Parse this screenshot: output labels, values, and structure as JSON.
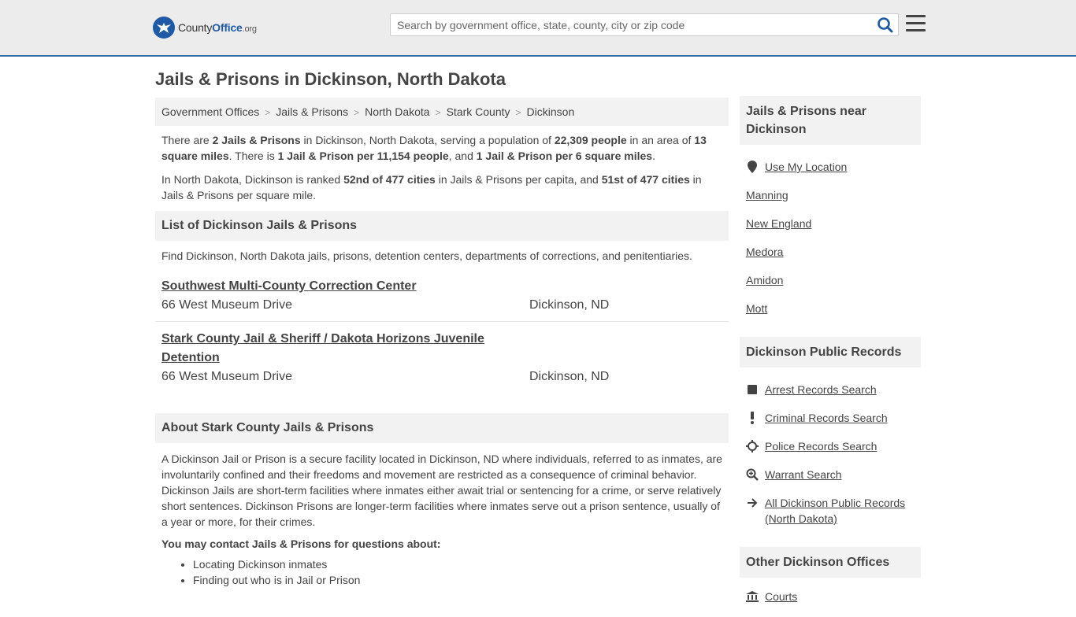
{
  "header": {
    "logo_part1": "County",
    "logo_part2": "Office",
    "logo_tld": ".org",
    "search_placeholder": "Search by government office, state, county, city or zip code"
  },
  "page_title": "Jails & Prisons in Dickinson, North Dakota",
  "breadcrumb": [
    "Government Offices",
    "Jails & Prisons",
    "North Dakota",
    "Stark County",
    "Dickinson"
  ],
  "intro": {
    "p1": {
      "t1": "There are ",
      "b1": "2 Jails & Prisons",
      "t2": " in Dickinson, North Dakota, serving a population of ",
      "b2": "22,309 people",
      "t3": " in an area of ",
      "b3": "13 square miles",
      "t4": ". There is ",
      "b4": "1 Jail & Prison per 11,154 people",
      "t5": ", and ",
      "b5": "1 Jail & Prison per 6 square miles",
      "t6": "."
    },
    "p2": {
      "t1": "In North Dakota, Dickinson is ranked ",
      "b1": "52nd of 477 cities",
      "t2": " in Jails & Prisons per capita, and ",
      "b2": "51st of 477 cities",
      "t3": " in Jails & Prisons per square mile."
    }
  },
  "list_section": {
    "title": "List of Dickinson Jails & Prisons",
    "description": "Find Dickinson, North Dakota jails, prisons, detention centers, departments of corrections, and penitentiaries.",
    "items": [
      {
        "name": "Southwest Multi-County Correction Center",
        "address": "66 West Museum Drive",
        "city": "Dickinson, ND"
      },
      {
        "name": "Stark County Jail & Sheriff / Dakota Horizons Juvenile Detention",
        "address": "66 West Museum Drive",
        "city": "Dickinson, ND"
      }
    ]
  },
  "about_section": {
    "title": "About Stark County Jails & Prisons",
    "text": "A Dickinson Jail or Prison is a secure facility located in Dickinson, ND where individuals, referred to as inmates, are involuntarily confined and their freedoms and movement are restricted as a consequence of criminal behavior. Dickinson Jails are short-term facilities where inmates either await trial or sentencing for a crime, or serve relatively short sentences. Dickinson Prisons are longer-term facilities where inmates serve out a prison sentence, usually of a year or more, for their crimes.",
    "contact_head": "You may contact Jails & Prisons for questions about:",
    "bullets": [
      "Locating Dickinson inmates",
      "Finding out who is in Jail or Prison"
    ]
  },
  "sidebar": {
    "near": {
      "title": "Jails & Prisons near Dickinson",
      "use_location": "Use My Location",
      "items": [
        "Manning",
        "New England",
        "Medora",
        "Amidon",
        "Mott"
      ]
    },
    "records": {
      "title": "Dickinson Public Records",
      "items": [
        {
          "label": "Arrest Records Search",
          "icon": "square-icon"
        },
        {
          "label": "Criminal Records Search",
          "icon": "exclamation-icon"
        },
        {
          "label": "Police Records Search",
          "icon": "crosshair-icon"
        },
        {
          "label": "Warrant Search",
          "icon": "magnifier-plus-icon"
        },
        {
          "label": "All Dickinson Public Records (North Dakota)",
          "icon": "arrow-right-icon"
        }
      ]
    },
    "other": {
      "title": "Other Dickinson Offices",
      "items": [
        {
          "label": "Courts",
          "icon": "courthouse-icon"
        }
      ]
    }
  }
}
